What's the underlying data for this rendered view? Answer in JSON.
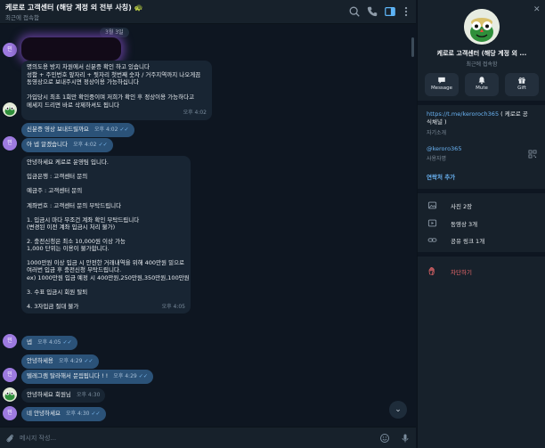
{
  "header": {
    "title": "케로로 고객센터 (해당 계정 외 전부 사칭) 🐢",
    "subtitle": "최근에 접속함",
    "icons": [
      "search-icon",
      "phone-icon",
      "sidebar-toggle-icon",
      "more-icon"
    ]
  },
  "messages": {
    "date_pill": "3월 3일",
    "items": [
      {
        "lines": [
          "명의도용 방지 차원에서 신분증 확인 하고 있습니다",
          "성함 + 주민번호 앞자리 + 뒷자리 첫번째 숫자 / 거주지역까지 나오게끔",
          "동영상으로 보내주시면 정상이용 가능하십니다",
          "",
          "가입당시 최초 1회만 확인중이며 저희가 확인 후 정상이용 가능하다고",
          "메세지 드리면 바로 삭제하셔도 됩니다"
        ],
        "time": "오후 4:02"
      },
      {
        "text": "신분증 영상 보내드릴까요",
        "time": "오후 4:02"
      },
      {
        "text": "아 넵 알겠습니다",
        "time": "오후 4:02"
      },
      {
        "lines": [
          "안녕하세요 케로로 운영팀 입니다.",
          "",
          "입금은행 : 고객센터 문의",
          "",
          "예금주 : 고객센터 문의",
          "",
          "계좌번호 : 고객센터 문의 부탁드립니다",
          "",
          "1. 입금시 마다 무조건 계좌 확인 부탁드립니다",
          "(변경된 이전 계좌 입금시 처리 불가)",
          "",
          "2. 충전신청은 최소 10,000원 이상 가능",
          "1,000 단위는 이용이 불가합니다.",
          "",
          "1000만원 이상 입금 시 안전한 거래내역을 위해 400만원 밑으로",
          "여러번 입금 후 충전신청 부탁드립니다.",
          "ex) 1000만원 입금 예정 시 400만원,250만원,350만원,100만원",
          "",
          "3. 수표 입금시 회원 탈퇴",
          "",
          "4. 3자입금 절대 불가"
        ],
        "time": "오후 4:05"
      },
      {
        "text": "넵",
        "time": "오후 4:05"
      },
      {
        "text": "안녕하세용",
        "time": "오후 4:29"
      },
      {
        "text": "텔레그램 탈라해서 문읨됩니다 ! !",
        "time": "오후 4:29"
      },
      {
        "text": "안녕하세요 회원님",
        "time": "오후 4:30"
      },
      {
        "text": "네 안녕하세요",
        "time": "오후 4:30"
      }
    ],
    "avatar_letter": "민"
  },
  "composer": {
    "placeholder": "메시지 작성..."
  },
  "profile": {
    "name": "케로로 고객센터 (해당 계정 외 ...",
    "status": "최근에 접속함",
    "actions": [
      {
        "label": "Message",
        "icon": "message-icon"
      },
      {
        "label": "Mute",
        "icon": "bell-icon"
      },
      {
        "label": "Gift",
        "icon": "gift-icon"
      }
    ],
    "bio_url": "https://t.me/keroroch365",
    "bio_text": " ( 케로로 공식채널 )",
    "bio_label": "자기소개",
    "username": "@keroro365",
    "username_label": "사용자명",
    "add_contact": "연락처 추가",
    "media": [
      {
        "icon": "photo-icon",
        "label": "사진 2장"
      },
      {
        "icon": "video-icon",
        "label": "동영상 3개"
      },
      {
        "icon": "link-icon",
        "label": "공유 링크 1개"
      }
    ],
    "block": "차단하기"
  },
  "colors": {
    "background": "#0e1621",
    "panel": "#17212b",
    "incoming_bubble": "#182533",
    "outgoing_bubble": "#2b5278",
    "accent": "#6ab3f3",
    "danger": "#e8676a"
  }
}
